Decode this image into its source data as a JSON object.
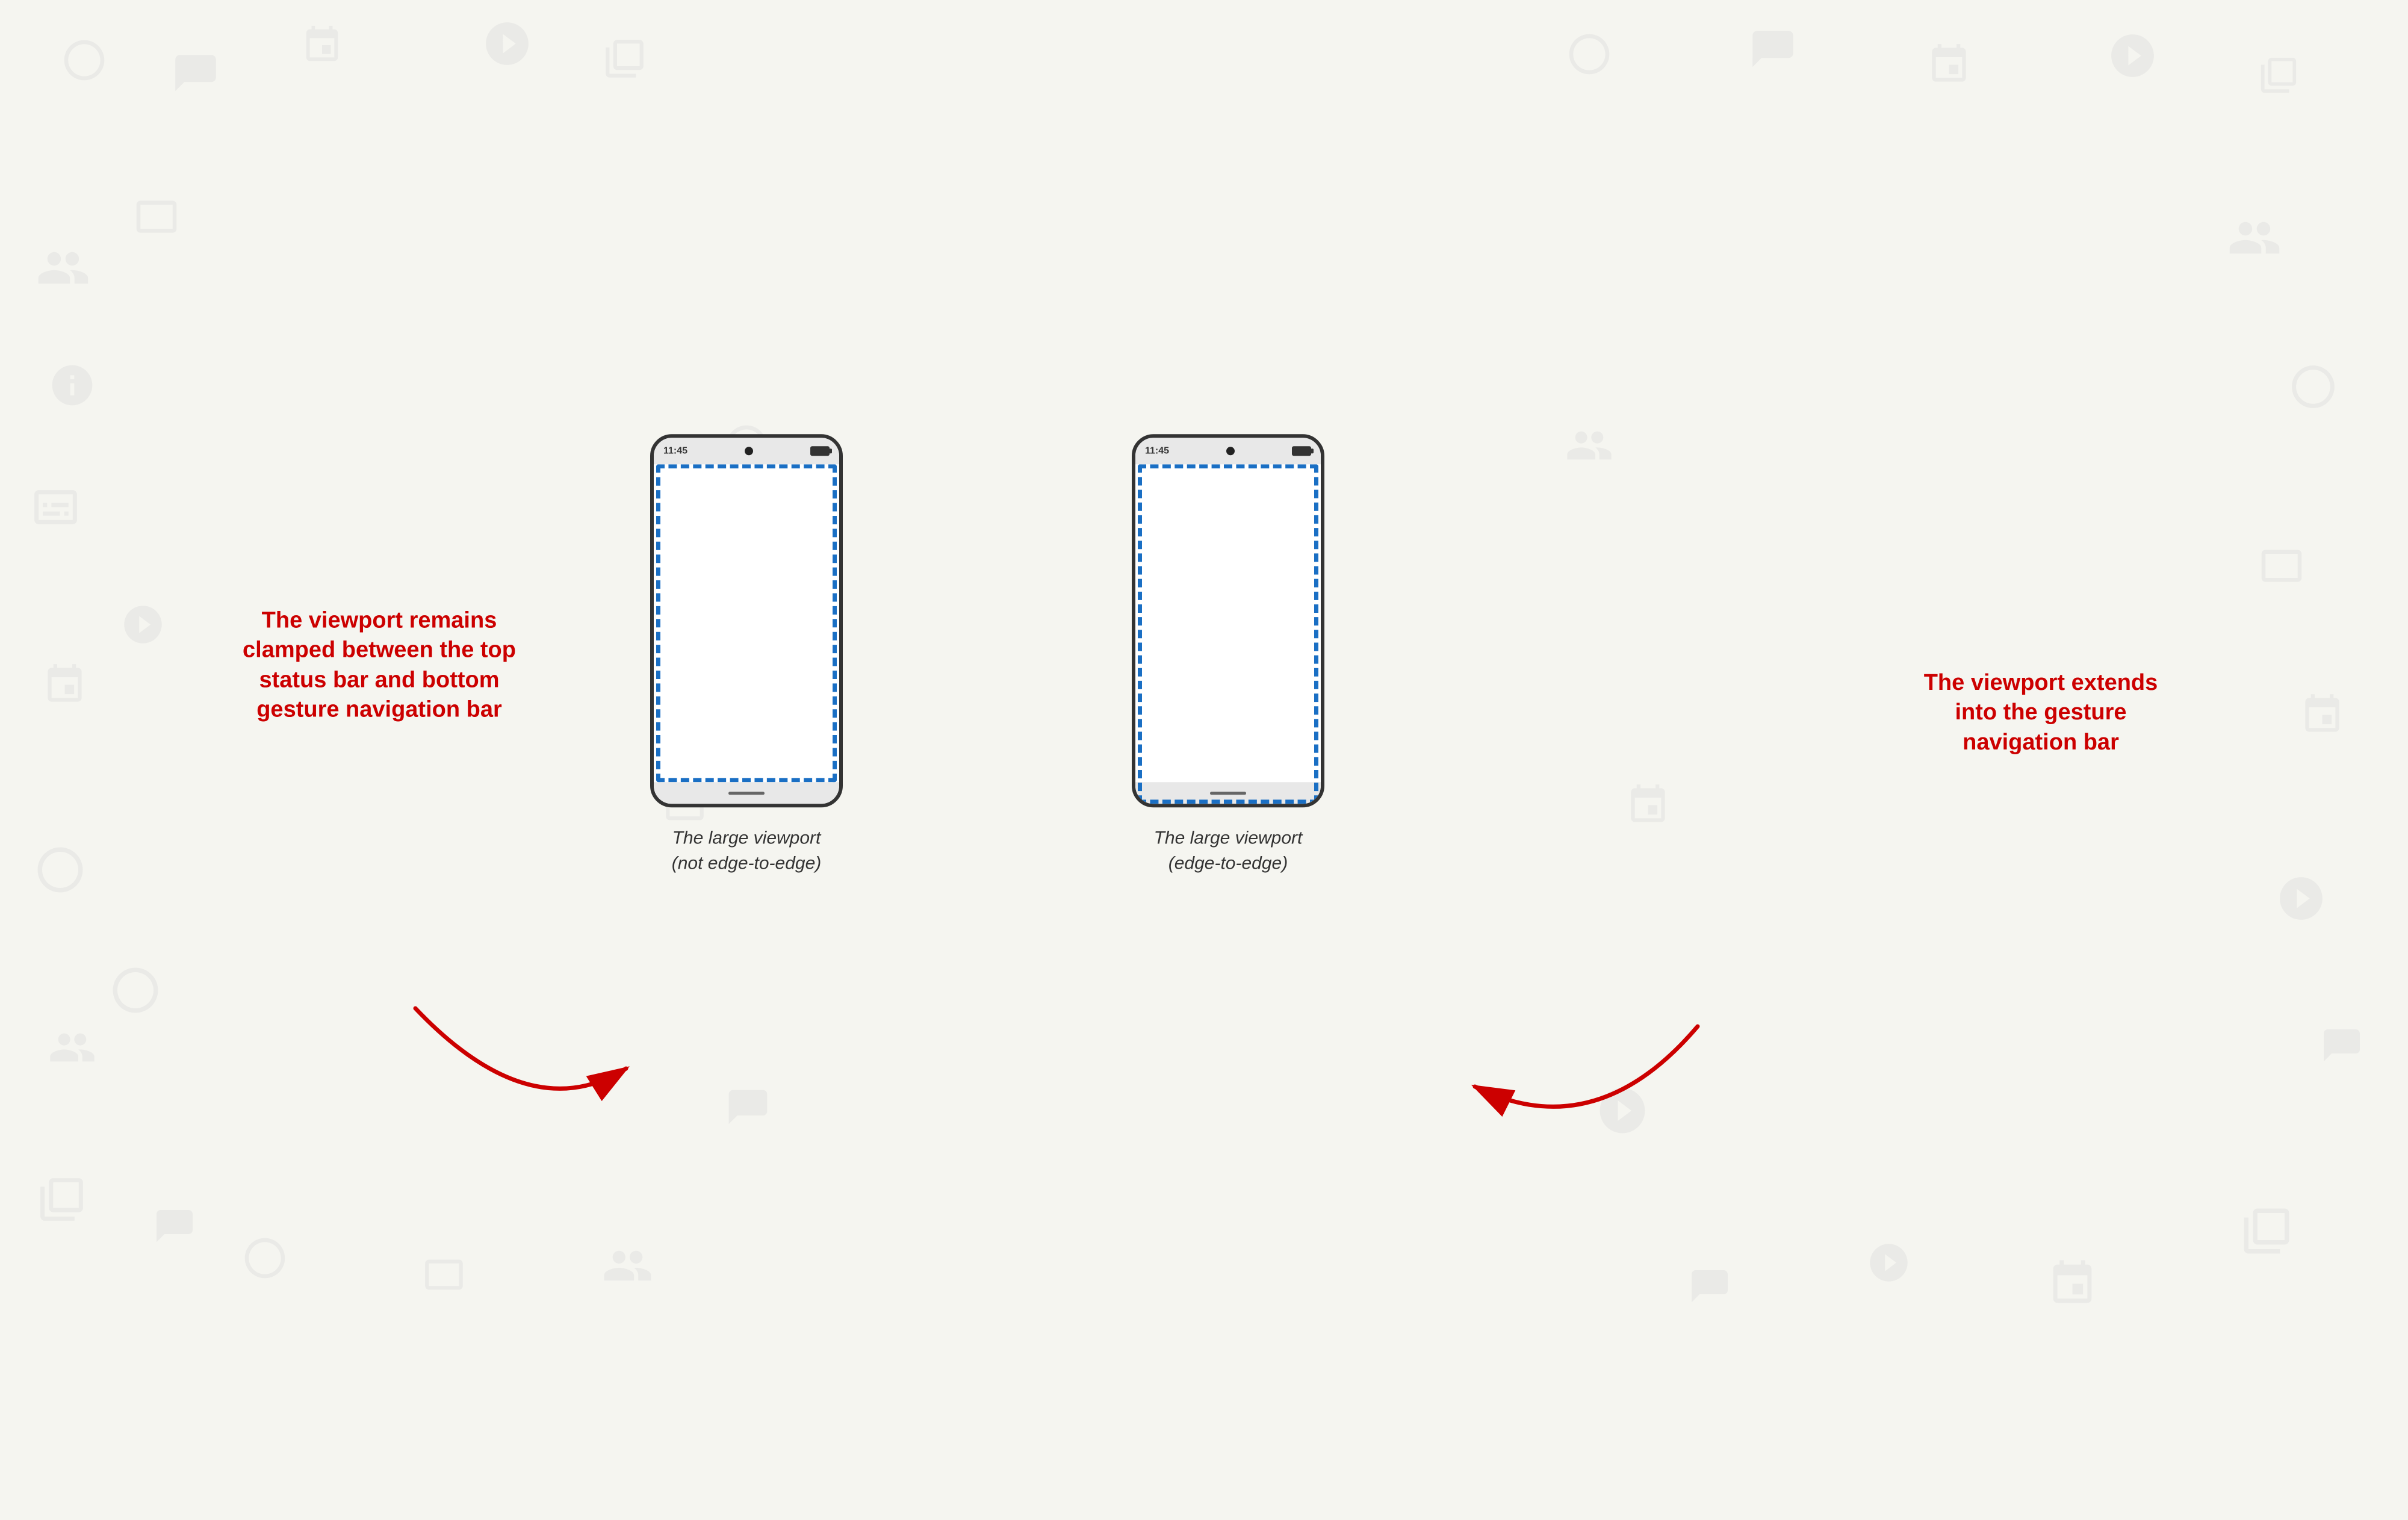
{
  "background": {
    "color": "#f5f5f0"
  },
  "phones": [
    {
      "id": "left",
      "type": "not-edge-to-edge",
      "status_time": "11:45",
      "viewport_style": "clamped",
      "caption_line1": "The large viewport",
      "caption_line2": "(not edge-to-edge)"
    },
    {
      "id": "right",
      "type": "edge-to-edge",
      "status_time": "11:45",
      "viewport_style": "extended",
      "caption_line1": "The large viewport",
      "caption_line2": "(edge-to-edge)"
    }
  ],
  "annotations": [
    {
      "id": "left-annotation",
      "text": "The viewport remains clamped between the top status bar and bottom gesture navigation bar",
      "position": "left"
    },
    {
      "id": "right-annotation",
      "text": "The viewport extends into the gesture navigation bar",
      "position": "right"
    }
  ],
  "arrows": [
    {
      "id": "arrow-left",
      "from": "left-annotation",
      "to": "left-phone-bottom",
      "direction": "right"
    },
    {
      "id": "arrow-right",
      "from": "right-annotation",
      "to": "right-phone-bottom",
      "direction": "left"
    }
  ]
}
